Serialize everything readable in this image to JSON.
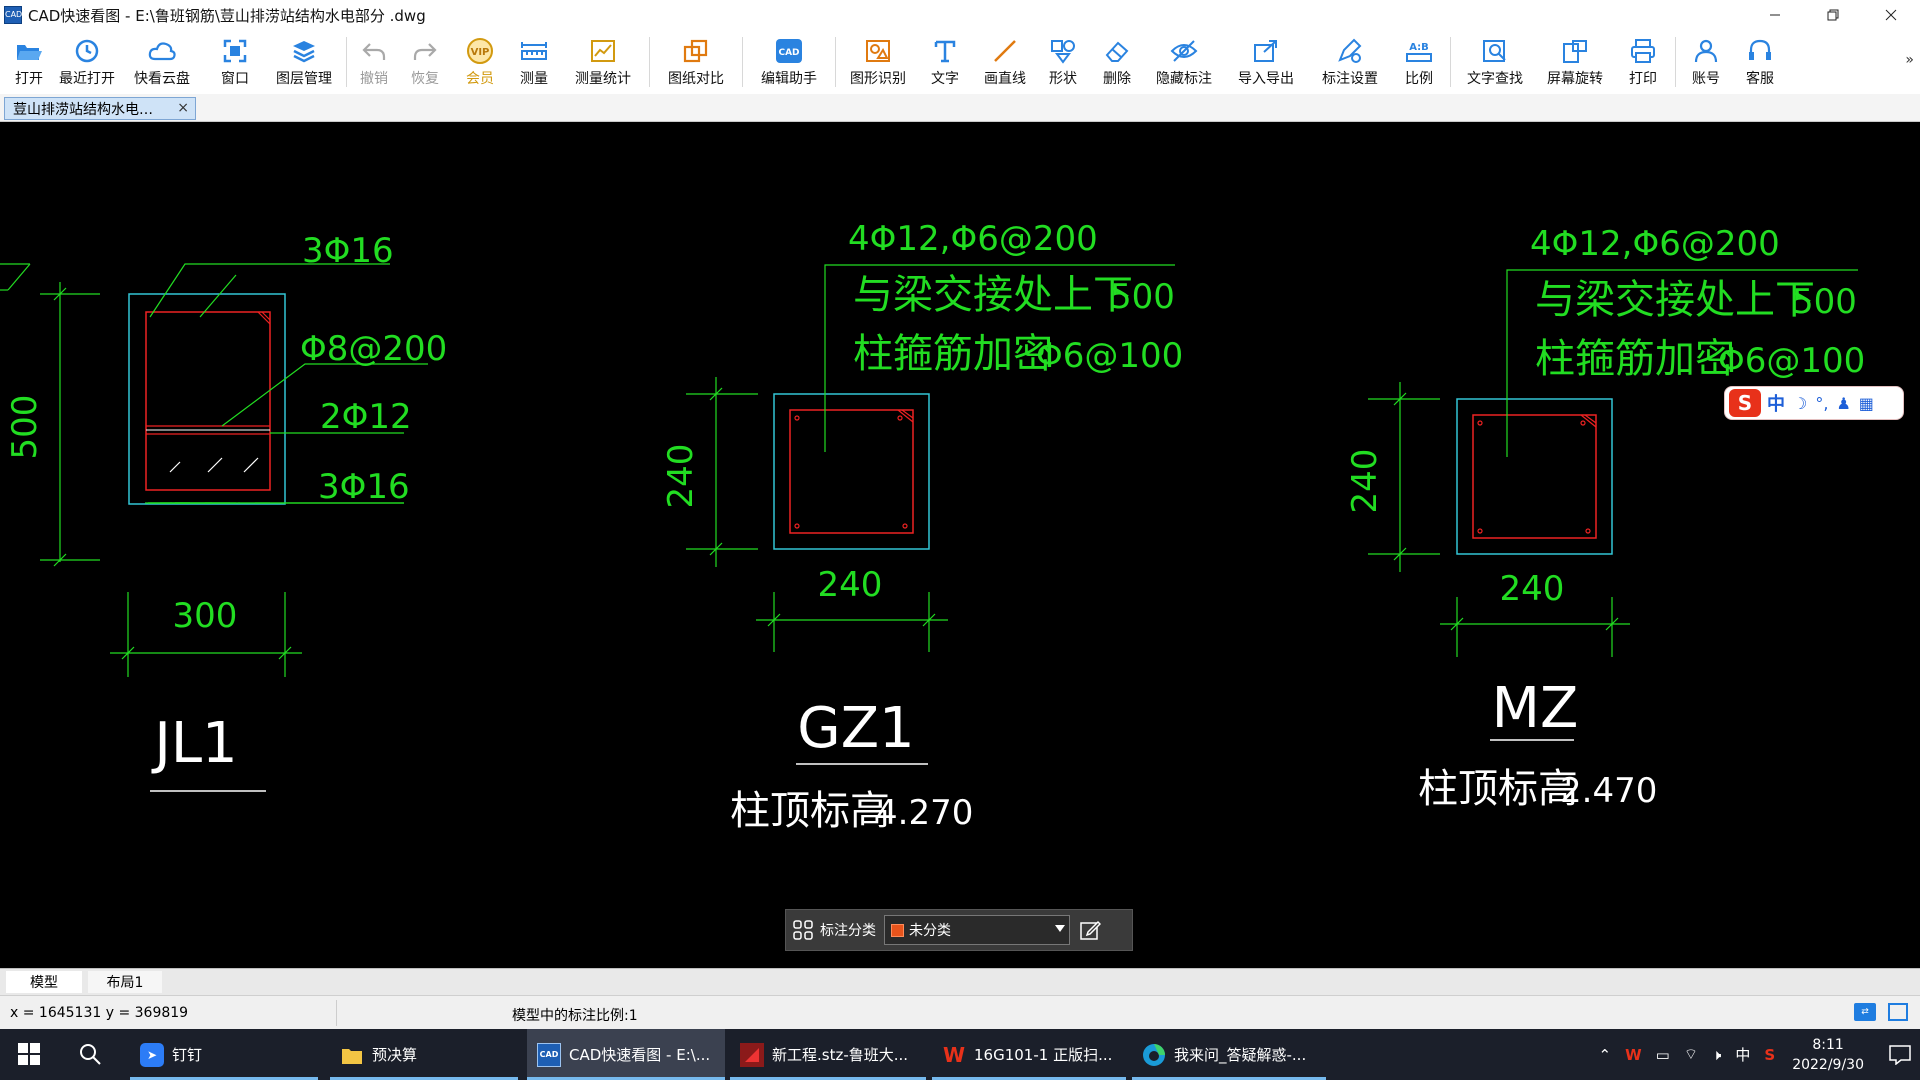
{
  "window": {
    "title": "CAD快速看图 - E:\\鲁班钢筋\\荳山排涝站结构水电部分 .dwg",
    "app_icon_text": "CAD",
    "controls": [
      "minimize",
      "restore",
      "close"
    ]
  },
  "toolbar": {
    "buttons": [
      {
        "label": "打开",
        "icon": "open-folder-icon"
      },
      {
        "label": "最近打开",
        "icon": "recent-clock-icon"
      },
      {
        "label": "快看云盘",
        "icon": "cloud-icon"
      },
      {
        "label": "窗口",
        "icon": "window-frame-icon"
      },
      {
        "label": "图层管理",
        "icon": "layers-icon"
      },
      {
        "label": "撤销",
        "icon": "undo-icon",
        "disabled": true
      },
      {
        "label": "恢复",
        "icon": "redo-icon",
        "disabled": true
      },
      {
        "label": "会员",
        "icon": "vip-badge-icon",
        "badge_text": "VIP"
      },
      {
        "label": "测量",
        "icon": "ruler-icon"
      },
      {
        "label": "测量统计",
        "icon": "measure-stats-icon"
      },
      {
        "label": "图纸对比",
        "icon": "compare-icon"
      },
      {
        "label": "编辑助手",
        "icon": "cad-edit-icon",
        "badge_text": "CAD"
      },
      {
        "label": "图形识别",
        "icon": "shape-recognize-icon"
      },
      {
        "label": "文字",
        "icon": "text-t-icon"
      },
      {
        "label": "画直线",
        "icon": "line-icon"
      },
      {
        "label": "形状",
        "icon": "shapes-icon"
      },
      {
        "label": "删除",
        "icon": "eraser-icon"
      },
      {
        "label": "隐藏标注",
        "icon": "hide-eye-icon"
      },
      {
        "label": "导入导出",
        "icon": "import-export-icon"
      },
      {
        "label": "标注设置",
        "icon": "annotation-settings-icon"
      },
      {
        "label": "比例",
        "icon": "scale-ab-icon",
        "badge_text": "A:B"
      },
      {
        "label": "文字查找",
        "icon": "text-search-icon"
      },
      {
        "label": "屏幕旋转",
        "icon": "screen-rotate-icon"
      },
      {
        "label": "打印",
        "icon": "printer-icon"
      },
      {
        "label": "账号",
        "icon": "user-icon"
      },
      {
        "label": "客服",
        "icon": "headset-icon"
      }
    ],
    "more_label": "»"
  },
  "doc_tabs": [
    {
      "label": "荳山排涝站结构水电…",
      "close": "×",
      "active": true
    }
  ],
  "drawing": {
    "jl1": {
      "top_bar": "3Φ16",
      "stirrup": "Φ8@200",
      "middle_bar": "2Φ12",
      "bottom_bar": "3Φ16",
      "height_dim": "500",
      "width_dim": "300",
      "name": "JL1"
    },
    "gz1": {
      "bars": "4Φ12,Φ6@200",
      "note_line1": "与梁交接处上下",
      "note_value1": "500",
      "note_line2": "柱箍筋加密",
      "note_value2": "Φ6@100",
      "height_dim": "240",
      "width_dim": "240",
      "name": "GZ1",
      "elevation_label": "柱顶标高",
      "elevation_value": "4.270"
    },
    "mz": {
      "bars": "4Φ12,Φ6@200",
      "note_line1": "与梁交接处上下",
      "note_value1": "500",
      "note_line2": "柱箍筋加密",
      "note_value2": "Φ6@100",
      "height_dim": "240",
      "width_dim": "240",
      "name": "MZ",
      "elevation_label": "柱顶标高",
      "elevation_value": "2.470"
    },
    "colors": {
      "background": "#000000",
      "text": "#22dd22",
      "concrete_outline": "#33c6d6",
      "rebar": "#ee2222",
      "dimension": "#22dd22",
      "title": "#ffffff"
    }
  },
  "annotation_bar": {
    "label": "标注分类",
    "selected": "未分类",
    "swatch_color": "#e8541c"
  },
  "layout_tabs": [
    {
      "label": "模型",
      "active": true
    },
    {
      "label": "布局1",
      "active": false
    }
  ],
  "status": {
    "coords": "x = 1645131  y = 369819",
    "scale_text": "模型中的标注比例:1"
  },
  "ime": {
    "logo": "S",
    "mode": "中"
  },
  "taskbar": {
    "apps": [
      {
        "label": "钉钉",
        "icon": "dingtalk-icon"
      },
      {
        "label": "预决算",
        "icon": "folder-icon"
      },
      {
        "label": "CAD快速看图 - E:\\...",
        "icon": "cad-app-icon",
        "active": true
      },
      {
        "label": "新工程.stz-鲁班大...",
        "icon": "luban-icon"
      },
      {
        "label": "16G101-1 正版扫...",
        "icon": "wps-icon"
      },
      {
        "label": "我来问_答疑解惑-...",
        "icon": "edge-icon"
      }
    ],
    "tray": {
      "ime_lang": "中",
      "time": "8:11",
      "date": "2022/9/30"
    }
  }
}
